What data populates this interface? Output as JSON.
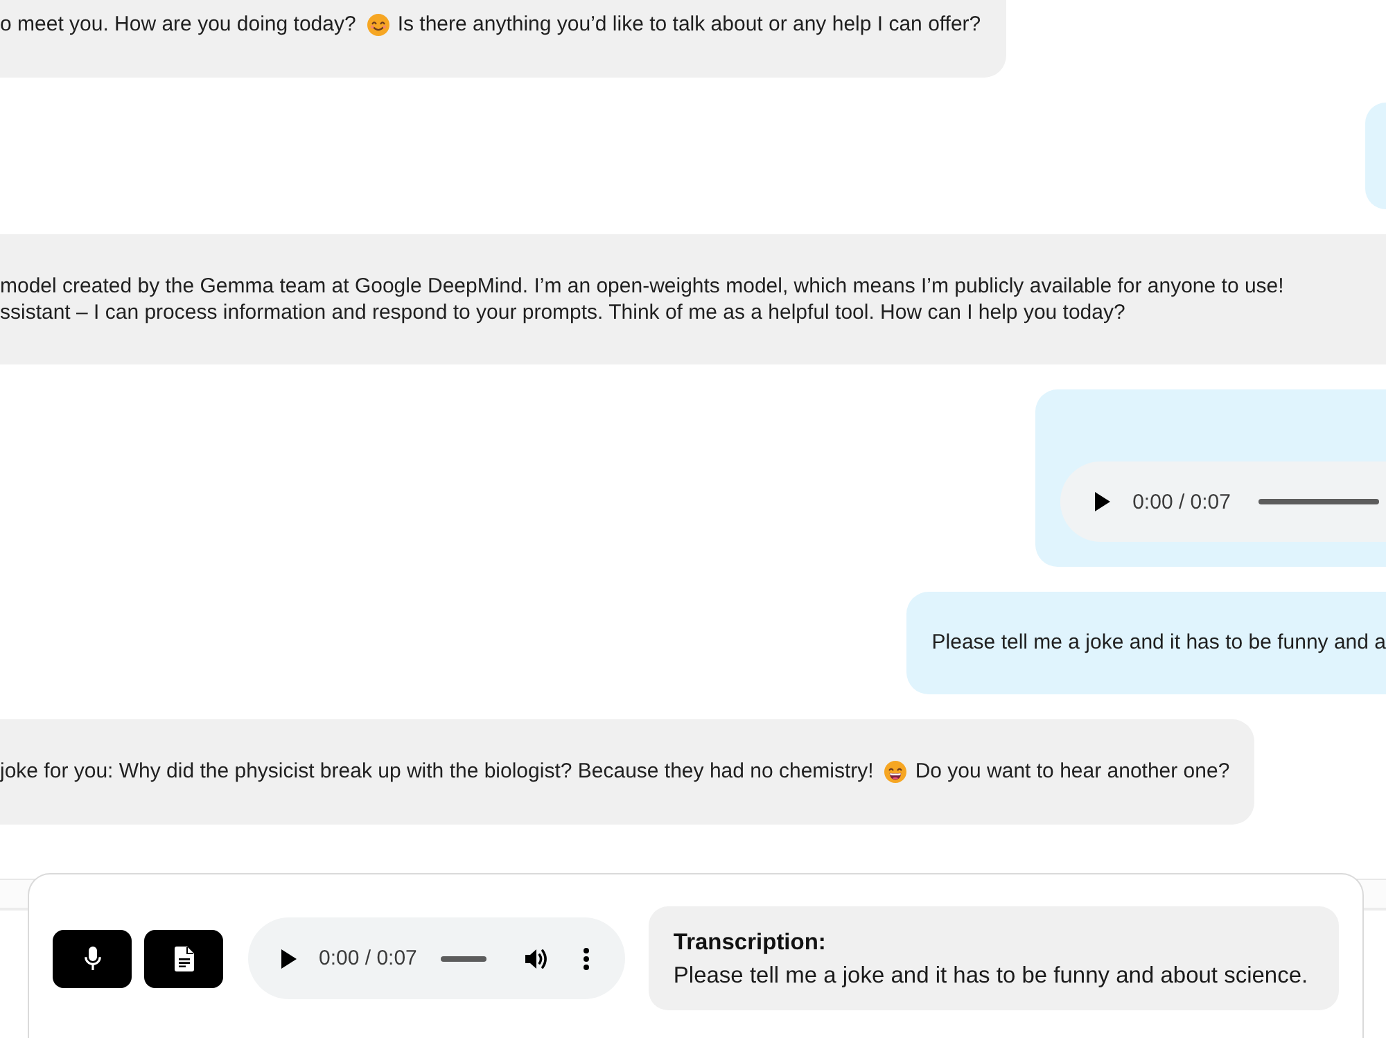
{
  "messages": [
    {
      "sent": false,
      "kind": "text",
      "segments": [
        {
          "kind": "text",
          "lines": [
            "o meet you. How are you doing today?"
          ]
        },
        {
          "kind": "smile"
        },
        {
          "kind": "text",
          "lines": [
            "Is there anything you’d like to talk about or any help I can offer?"
          ]
        }
      ]
    },
    {
      "sent": true,
      "kind": "blank"
    },
    {
      "sent": false,
      "kind": "text",
      "segments": [
        {
          "kind": "text",
          "lines": [
            "model created by the Gemma team at Google DeepMind. I’m an open-weights model, which means I’m publicly available for anyone to use!",
            "ssistant – I can process information and respond to your prompts. Think of me as a helpful tool. How can I help you today?"
          ]
        }
      ]
    },
    {
      "sent": true,
      "kind": "audio",
      "player": {
        "time": "0:00 / 0:07"
      }
    },
    {
      "sent": true,
      "kind": "text",
      "segments": [
        {
          "kind": "text",
          "lines": [
            "Please tell me a joke and it has to be funny and a"
          ]
        }
      ]
    },
    {
      "sent": false,
      "kind": "text",
      "segments": [
        {
          "kind": "text",
          "lines": [
            "joke for you: Why did the physicist break up with the biologist? Because they had no chemistry!"
          ]
        },
        {
          "kind": "grin"
        },
        {
          "kind": "text",
          "lines": [
            "Do you want to hear another one?"
          ]
        }
      ]
    }
  ],
  "composer": {
    "audio_player": {
      "time": "0:00 / 0:07"
    },
    "transcription": {
      "title": "Transcription:",
      "text": "Please tell me a joke and it has to be funny and about science."
    }
  }
}
